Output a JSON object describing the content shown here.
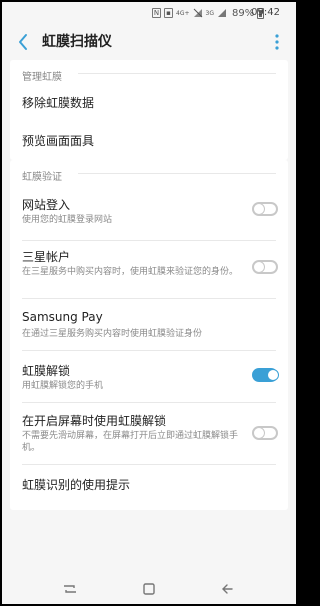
{
  "status_bar": {
    "icons": [
      "nfc-icon",
      "sim-icon",
      "4g-plus-icon",
      "wifi-off-icon",
      "3g-icon",
      "signal-icon"
    ],
    "battery": "89%",
    "time": "09:42"
  },
  "app_bar": {
    "title": "虹膜扫描仪",
    "back_icon": "back-arrow-icon",
    "more_icon": "more-vert-icon"
  },
  "sections": [
    {
      "title": "管理虹膜",
      "items": [
        {
          "label": "移除虹膜数据"
        },
        {
          "label": "预览画面面具"
        }
      ]
    },
    {
      "title": "虹膜验证",
      "items": [
        {
          "label": "网站登入",
          "subtitle": "使用您的虹膜登录网站",
          "toggle": false
        },
        {
          "label": "三星帐户",
          "subtitle": "在三星服务中购买内容时，使用虹膜来验证您的身份。",
          "toggle": false
        },
        {
          "label": "Samsung Pay",
          "subtitle": "在通过三星服务购买内容时使用虹膜验证身份"
        },
        {
          "label": "虹膜解锁",
          "subtitle": "用虹膜解锁您的手机",
          "toggle": true
        },
        {
          "label": "在开启屏幕时使用虹膜解锁",
          "subtitle": "不需要先滑动屏幕，在屏幕打开后立即通过虹膜解锁手机。",
          "toggle": false
        }
      ]
    },
    {
      "items": [
        {
          "label": "虹膜识别的使用提示"
        }
      ]
    }
  ],
  "nav_bar": {
    "icons": [
      "recents-icon",
      "home-icon",
      "back-icon"
    ]
  },
  "colors": {
    "accent": "#3aa0d6",
    "background": "#f6f6f6"
  }
}
